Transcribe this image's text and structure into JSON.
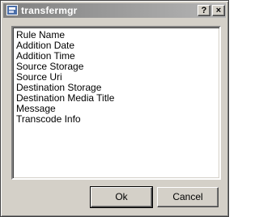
{
  "window": {
    "title": "transfermgr",
    "help_label": "?",
    "close_label": "×"
  },
  "list": {
    "items": [
      "Rule Name",
      "Addition Date",
      "Addition Time",
      "Source Storage",
      "Source Uri",
      "Destination Storage",
      "Destination Media Title",
      "Message",
      "Transcode Info"
    ]
  },
  "buttons": {
    "ok_label": "Ok",
    "cancel_label": "Cancel"
  }
}
